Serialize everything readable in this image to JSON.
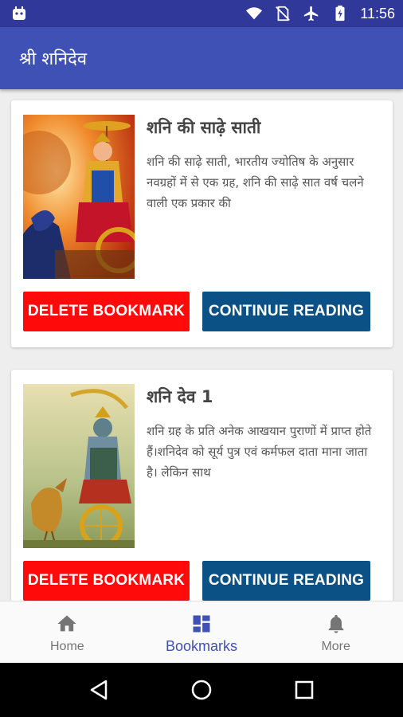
{
  "status_bar": {
    "time": "11:56"
  },
  "app_bar": {
    "title": "श्री शनिदेव"
  },
  "bookmarks": [
    {
      "title": "शनि की साढ़े साती",
      "excerpt": "शनि की साढ़े साती, भारतीय ज्योतिष के अनुसार नवग्रहों में से एक ग्रह, शनि की साढ़े सात वर्ष चलने वाली एक प्रकार की",
      "delete_label": "DELETE BOOKMARK",
      "continue_label": "CONTINUE READING"
    },
    {
      "title": "शनि देव 1",
      "excerpt": "शनि ग्रह के प्रति अनेक आखयान पुराणों में प्राप्त होते हैं।शनिदेव को सूर्य पुत्र एवं कर्मफल दाता माना जाता है। लेकिन साथ",
      "delete_label": "DELETE BOOKMARK",
      "continue_label": "CONTINUE READING"
    }
  ],
  "bottom_nav": {
    "items": [
      {
        "label": "Home",
        "icon": "home-icon"
      },
      {
        "label": "Bookmarks",
        "icon": "dashboard-icon",
        "active": true
      },
      {
        "label": "More",
        "icon": "bell-icon"
      }
    ]
  },
  "colors": {
    "app_bar": "#3f51b5",
    "status_bar": "#30389a",
    "delete_button": "#ff0a0a",
    "continue_button": "#0b5186",
    "nav_active": "#3f51b5"
  }
}
